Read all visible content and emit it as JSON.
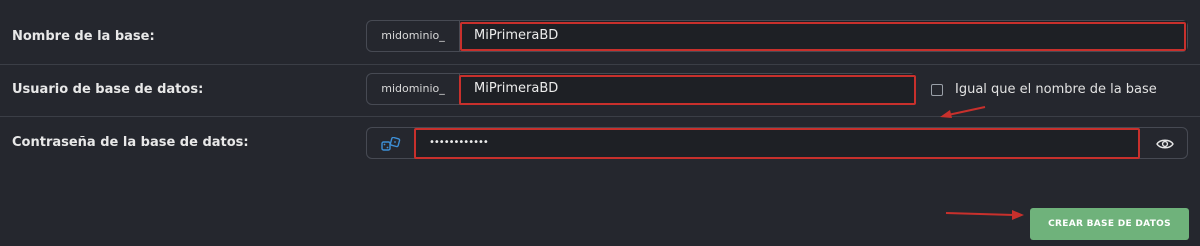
{
  "rows": [
    {
      "label": "Nombre de la base:",
      "prefix": "midominio_",
      "value": "MiPrimeraBD"
    },
    {
      "label": "Usuario de base de datos:",
      "prefix": "midominio_",
      "value": "MiPrimeraBD",
      "checkbox_label": "Igual que el nombre de la base",
      "checkbox_checked": false
    },
    {
      "label": "Contraseña de la base de datos:",
      "value": "••••••••••••"
    }
  ],
  "icons": {
    "password_generate": "dice-icon",
    "password_toggle": "eye-icon"
  },
  "submit_label": "CREAR BASE DE DATOS",
  "colors": {
    "background": "#25272e",
    "annotation": "#c8302c",
    "button": "#6fb27b",
    "link_icon": "#3d8fd6"
  }
}
